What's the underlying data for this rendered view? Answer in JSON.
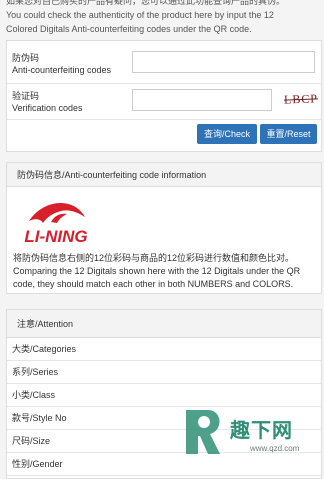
{
  "intro": {
    "line1": "如果您对自己购买的产品有疑问，您可以通过此功能查询产品的真伪。",
    "line2": "You could check the authenticity of the product here by input the 12",
    "line3": "Colored Digitals Anti-counterfeiting codes under the QR code."
  },
  "form": {
    "code_label_cn": "防伪码",
    "code_label_en": "Anti-counterfeiting codes",
    "code_value": "",
    "verify_label_cn": "验证码",
    "verify_label_en": "Verification codes",
    "verify_value": "",
    "captcha_text": "LBCP",
    "check_button": "查询/Check",
    "reset_button": "重置/Reset"
  },
  "info": {
    "header": "防伪码信息/Anti-counterfeiting code information",
    "logo_text": "LI-NING",
    "desc_line1": "将防伪码信息右侧的12位彩码与商品的12位彩码进行数值和颜色比对。",
    "desc_line2": "Comparing the 12 Digitals shown here with the 12 Digitals under the QR",
    "desc_line3": "code, they should match each other in both NUMBERS and COLORS."
  },
  "attention": {
    "header": "注意/Attention",
    "rows": [
      "大类/Categories",
      "系列/Series",
      "小类/Class",
      "款号/Style No",
      "尺码/Size",
      "性别/Gender"
    ]
  },
  "watermark": {
    "cn": "趣下网",
    "url": "www.qzd.com"
  },
  "colors": {
    "button": "#2e72b8",
    "logo_red": "#d8202a",
    "watermark": "#2f8f77"
  }
}
